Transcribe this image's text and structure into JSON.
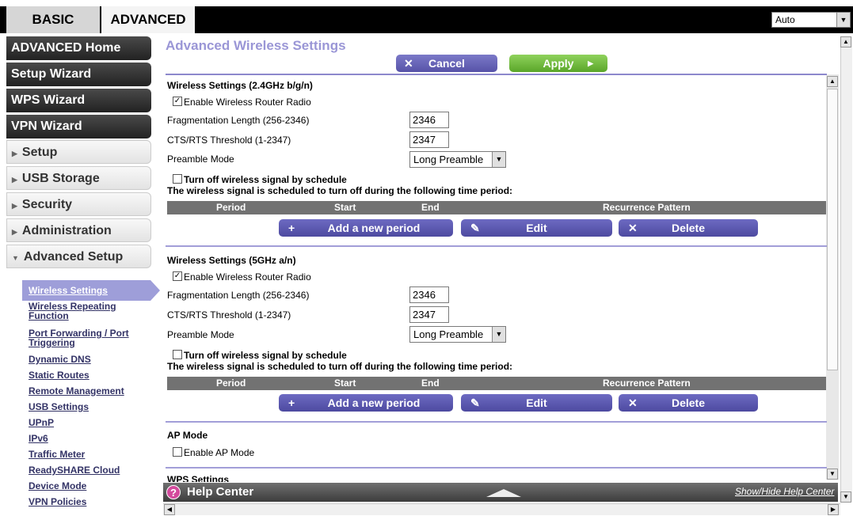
{
  "top_tabs": {
    "basic": "BASIC",
    "advanced": "ADVANCED"
  },
  "language": {
    "selected": "Auto"
  },
  "nav": {
    "advanced_home": "ADVANCED Home",
    "setup_wizard": "Setup Wizard",
    "wps_wizard": "WPS Wizard",
    "vpn_wizard": "VPN Wizard",
    "setup": "Setup",
    "usb_storage": "USB Storage",
    "security": "Security",
    "administration": "Administration",
    "advanced_setup": "Advanced Setup",
    "subitems": [
      "Wireless Settings",
      "Wireless Repeating Function",
      "Port Forwarding / Port Triggering",
      "Dynamic DNS",
      "Static Routes",
      "Remote Management",
      "USB Settings",
      "UPnP",
      "IPv6",
      "Traffic Meter",
      "ReadySHARE Cloud",
      "Device Mode",
      "VPN Policies"
    ]
  },
  "page": {
    "title": "Advanced Wireless Settings",
    "cancel": "Cancel",
    "apply": "Apply"
  },
  "wifi24": {
    "title": "Wireless Settings (2.4GHz b/g/n)",
    "enable_radio": "Enable Wireless Router Radio",
    "enable_radio_checked": true,
    "frag_label": "Fragmentation Length (256-2346)",
    "frag_value": "2346",
    "rts_label": "CTS/RTS Threshold (1-2347)",
    "rts_value": "2347",
    "preamble_label": "Preamble Mode",
    "preamble_value": "Long Preamble",
    "schedule_label": "Turn off wireless signal by schedule",
    "schedule_checked": false,
    "schedule_note": "The wireless signal is scheduled to turn off during the following time period:"
  },
  "wifi5": {
    "title": "Wireless Settings (5GHz a/n)",
    "enable_radio": "Enable Wireless Router Radio",
    "enable_radio_checked": true,
    "frag_label": "Fragmentation Length (256-2346)",
    "frag_value": "2346",
    "rts_label": "CTS/RTS Threshold (1-2347)",
    "rts_value": "2347",
    "preamble_label": "Preamble Mode",
    "preamble_value": "Long Preamble",
    "schedule_label": "Turn off wireless signal by schedule",
    "schedule_checked": false,
    "schedule_note": "The wireless signal is scheduled to turn off during the following time period:"
  },
  "table": {
    "period": "Period",
    "start": "Start",
    "end": "End",
    "recurrence": "Recurrence Pattern"
  },
  "period_buttons": {
    "add": "Add a new period",
    "edit": "Edit",
    "delete": "Delete"
  },
  "ap_mode": {
    "title": "AP Mode",
    "enable": "Enable AP Mode",
    "checked": false
  },
  "wps_peek": "WPS Settings",
  "help": {
    "title": "Help Center",
    "link": "Show/Hide Help Center"
  }
}
